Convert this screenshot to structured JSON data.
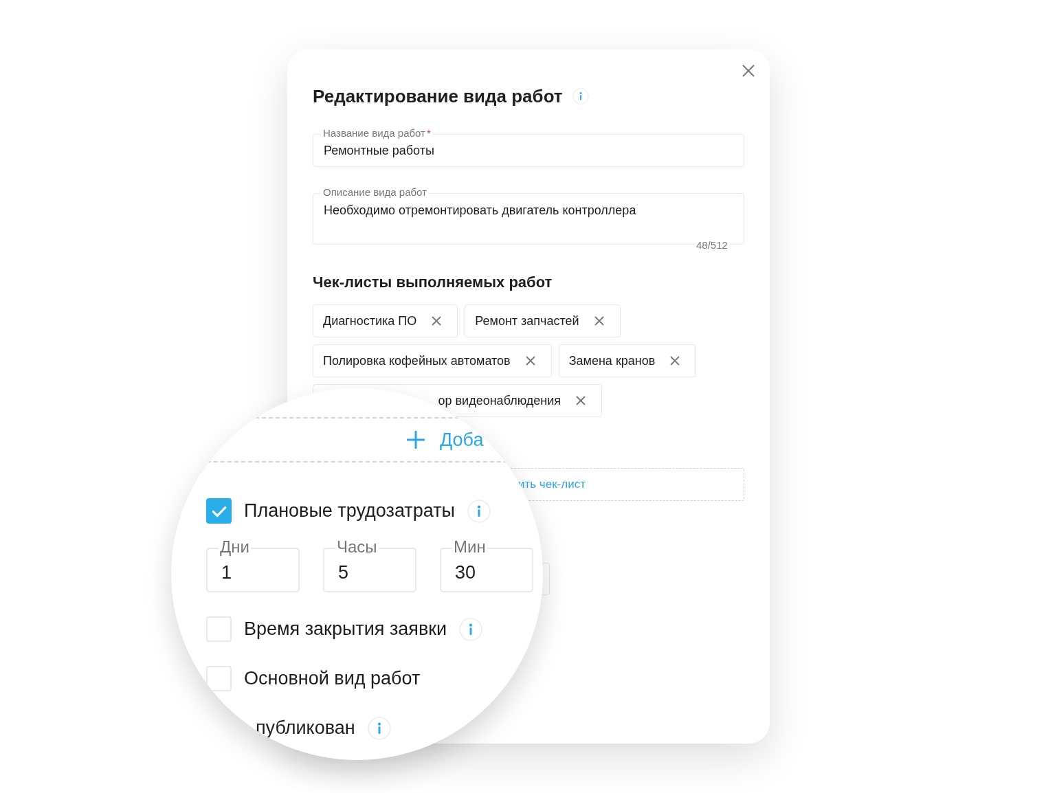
{
  "dialog": {
    "title": "Редактирование вида работ"
  },
  "fields": [
    {
      "label": "Название вида работ",
      "required_mark": "*",
      "value": "Ремонтные работы"
    },
    {
      "label": "Описание вида работ",
      "value": "Необходимо отремонтировать двигатель контроллера",
      "counter": "48/512"
    }
  ],
  "checklists": {
    "title": "Чек-листы выполняемых работ",
    "items": [
      "Диагностика ПО",
      "Ремонт запчастей",
      "Полировка кофейных автоматов",
      "Замена кранов",
      "ор видеонаблюдения"
    ],
    "add_button": "ить чек-лист"
  },
  "magnifier": {
    "add_button": "Доба",
    "options": [
      {
        "label": "Плановые трудозатраты",
        "checked": true,
        "info": true
      },
      {
        "label": "Время закрытия заявки",
        "checked": false,
        "info": true
      },
      {
        "label": "Основной вид работ",
        "checked": false,
        "info": false
      },
      {
        "label": "публикован",
        "info": true
      }
    ],
    "duration": [
      {
        "label": "Дни",
        "value": "1"
      },
      {
        "label": "Часы",
        "value": "5"
      },
      {
        "label": "Мин",
        "value": "30"
      }
    ]
  }
}
